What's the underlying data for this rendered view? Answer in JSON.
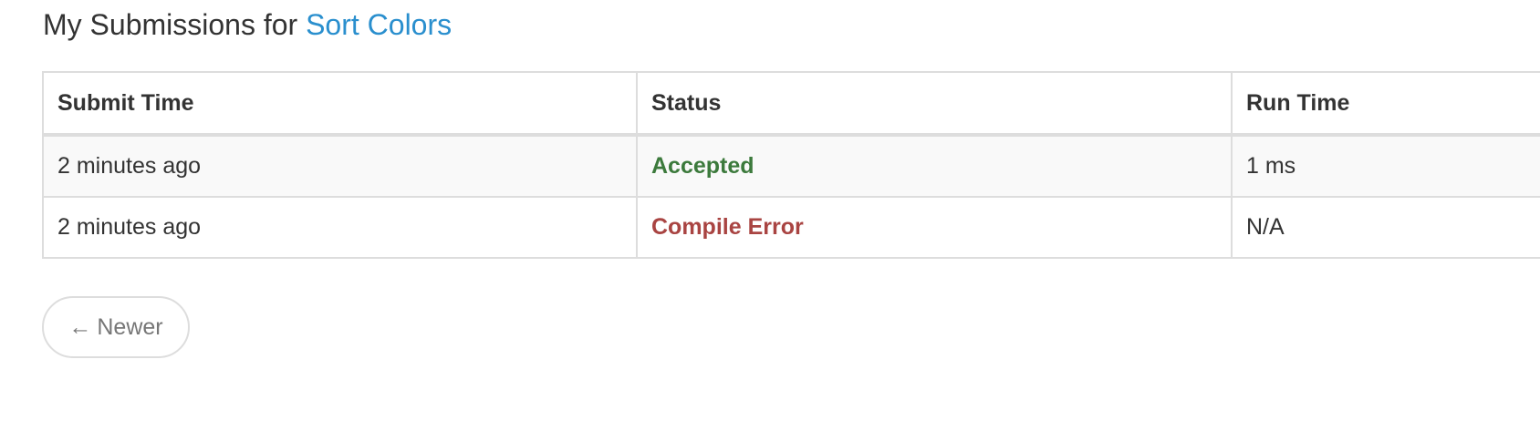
{
  "header": {
    "title_prefix": "My Submissions for",
    "problem_link": "Sort Colors"
  },
  "table": {
    "columns": [
      "Submit Time",
      "Status",
      "Run Time"
    ],
    "rows": [
      {
        "submit_time": "2 minutes ago",
        "status": "Accepted",
        "run_time": "1 ms"
      },
      {
        "submit_time": "2 minutes ago",
        "status": "Compile Error",
        "run_time": "N/A"
      }
    ]
  },
  "pager": {
    "arrow": "←",
    "label": "Newer"
  },
  "colors": {
    "link": "#2a8fce",
    "accepted": "#3c7a3c",
    "compile_error": "#a94442",
    "border": "#dddddd"
  },
  "icons": {
    "pager_arrow": "left-arrow-icon"
  }
}
